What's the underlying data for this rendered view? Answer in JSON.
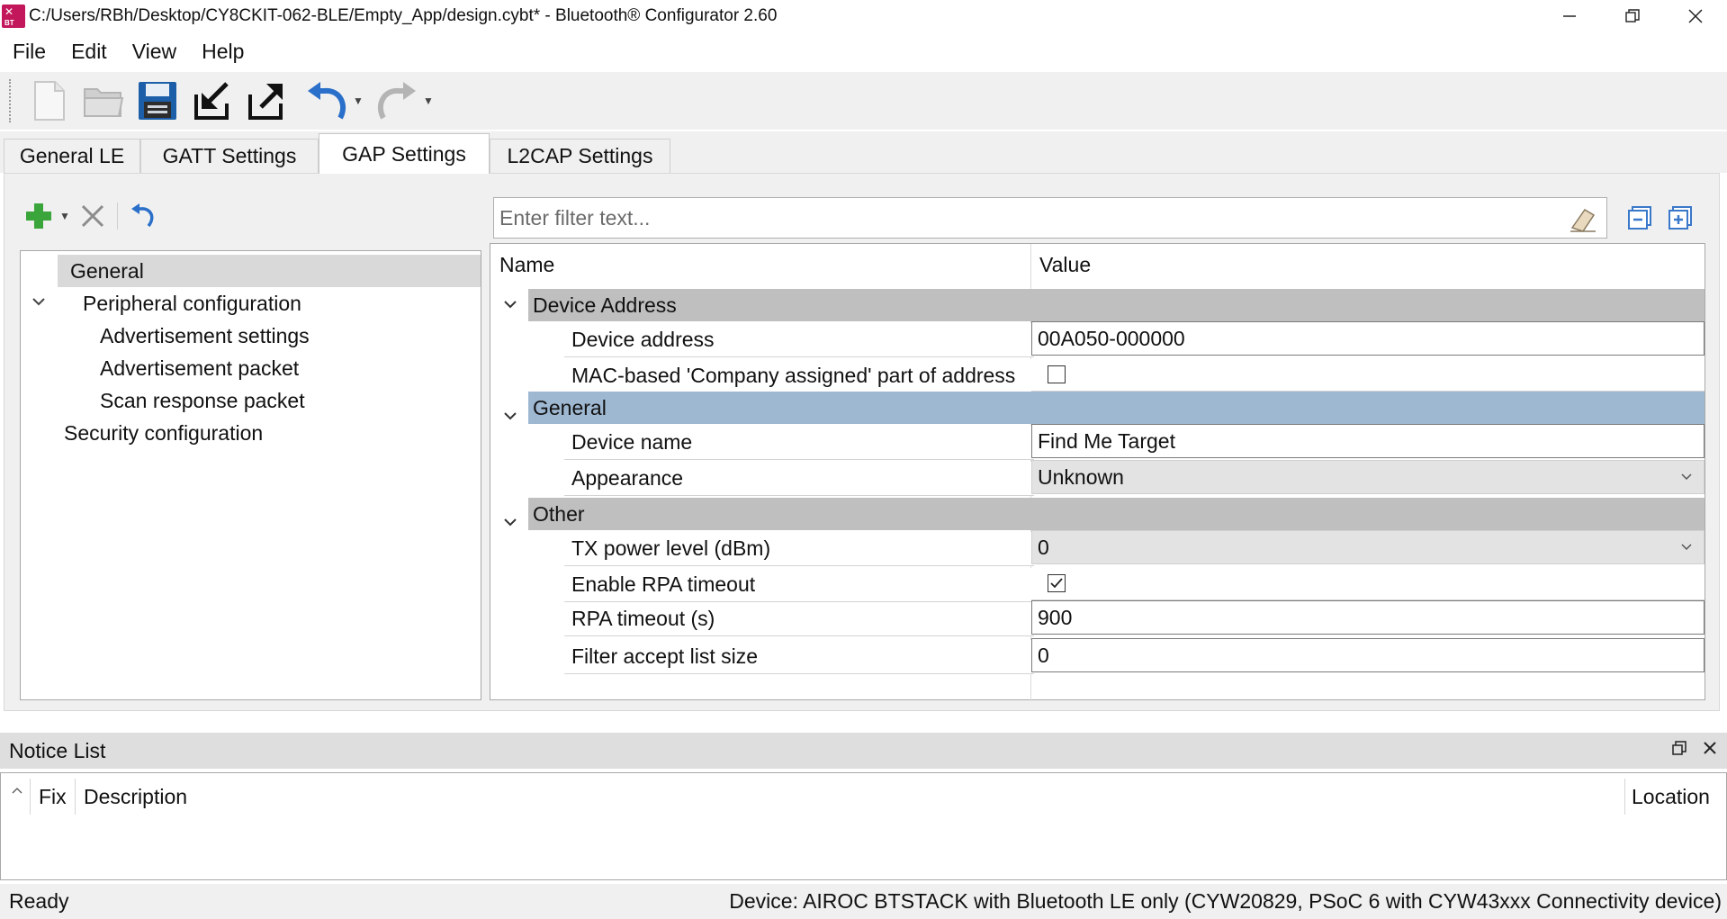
{
  "window": {
    "title": "C:/Users/RBh/Desktop/CY8CKIT-062-BLE/Empty_App/design.cybt* - Bluetooth® Configurator 2.60",
    "icon_label": "BT",
    "controls": [
      "minimize-icon",
      "restore-icon",
      "close-icon"
    ]
  },
  "menu": {
    "items": [
      "File",
      "Edit",
      "View",
      "Help"
    ]
  },
  "toolbar": {
    "buttons": [
      "new-file-icon",
      "open-file-icon",
      "save-icon",
      "import-icon",
      "export-icon",
      "undo-icon",
      "redo-icon"
    ]
  },
  "tabs": [
    {
      "label": "General LE",
      "active": false
    },
    {
      "label": "GATT Settings",
      "active": false
    },
    {
      "label": "GAP Settings",
      "active": true
    },
    {
      "label": "L2CAP Settings",
      "active": false
    }
  ],
  "tree": {
    "items": [
      {
        "label": "General",
        "selected": true
      },
      {
        "label": "Peripheral configuration",
        "expanded": true
      },
      {
        "label": "Advertisement settings"
      },
      {
        "label": "Advertisement packet"
      },
      {
        "label": "Scan response packet"
      },
      {
        "label": "Security configuration"
      }
    ]
  },
  "filter": {
    "placeholder": "Enter filter text..."
  },
  "grid": {
    "col_name": "Name",
    "col_value": "Value",
    "groups": {
      "device_address": "Device Address",
      "general": "General",
      "other": "Other"
    },
    "props": {
      "device_address": {
        "name": "Device address",
        "value": "00A050-000000"
      },
      "mac_based": {
        "name": "MAC-based 'Company assigned' part of address",
        "checked": false
      },
      "device_name": {
        "name": "Device name",
        "value": "Find Me Target"
      },
      "appearance": {
        "name": "Appearance",
        "value": "Unknown"
      },
      "tx_power": {
        "name": "TX power level (dBm)",
        "value": "0"
      },
      "enable_rpa": {
        "name": "Enable RPA timeout",
        "checked": true
      },
      "rpa_timeout": {
        "name": "RPA timeout (s)",
        "value": "900"
      },
      "filter_list": {
        "name": "Filter accept list size",
        "value": "0"
      }
    }
  },
  "notice": {
    "title": "Notice List",
    "col_fix": "Fix",
    "col_description": "Description",
    "col_location": "Location"
  },
  "status": {
    "left": "Ready",
    "right": "Device: AIROC BTSTACK with Bluetooth LE only (CYW20829, PSoC 6 with CYW43xxx Connectivity device)"
  },
  "colors": {
    "selected_group": "#9fb8d2",
    "group": "#bfbfbf",
    "undo_blue": "#2a6fc9",
    "add_green": "#3aa53a",
    "panel": "#f0f0f0"
  }
}
